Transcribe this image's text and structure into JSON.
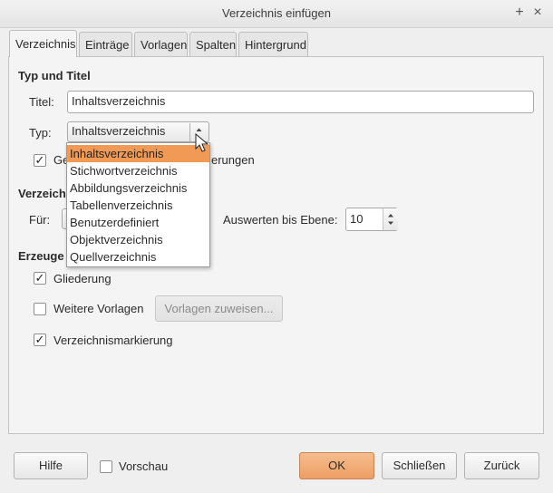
{
  "window": {
    "title": "Verzeichnis einfügen",
    "maximize_symbol": "+",
    "close_symbol": "×"
  },
  "tabs": [
    {
      "label": "Verzeichnis"
    },
    {
      "label": "Einträge"
    },
    {
      "label": "Vorlagen"
    },
    {
      "label": "Spalten"
    },
    {
      "label": "Hintergrund"
    }
  ],
  "type_title": {
    "heading": "Typ und Titel",
    "title_label": "Titel:",
    "title_value": "Inhaltsverzeichnis",
    "type_label": "Typ:",
    "type_value": "Inhaltsverzeichnis",
    "protected_label_start": "Ge",
    "protected_label_end": "erungen",
    "protected_checked": true
  },
  "type_options": [
    "Inhaltsverzeichnis",
    "Stichwortverzeichnis",
    "Abbildungsverzeichnis",
    "Tabellenverzeichnis",
    "Benutzerdefiniert",
    "Objektverzeichnis",
    "Quellverzeichnis"
  ],
  "scope": {
    "heading_visible": "Verzeichni",
    "for_label": "Für:",
    "evaluate_label": "Auswerten bis Ebene:",
    "evaluate_value": "10"
  },
  "create_from": {
    "heading_visible": "Erzeuge",
    "outline_label": "Gliederung",
    "outline_checked": true,
    "more_styles_label": "Weitere Vorlagen",
    "more_styles_checked": false,
    "assign_styles_button": "Vorlagen zuweisen...",
    "index_marks_label": "Verzeichnismarkierung",
    "index_marks_checked": true
  },
  "footer": {
    "help": "Hilfe",
    "preview_label": "Vorschau",
    "preview_checked": false,
    "ok": "OK",
    "close": "Schließen",
    "reset": "Zurück"
  },
  "colors": {
    "accent": "#f19a55",
    "ok_button": "#ee9e63"
  },
  "check_glyph": "✓"
}
